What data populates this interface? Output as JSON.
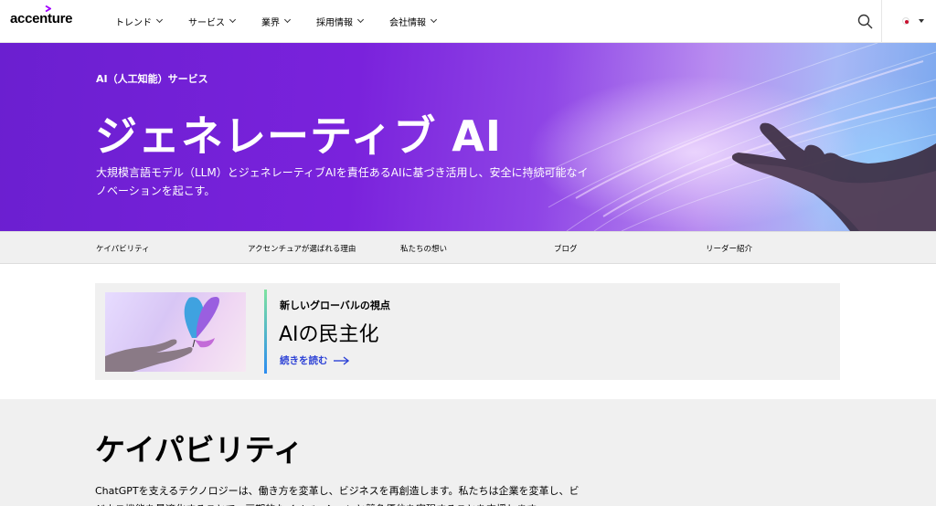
{
  "header": {
    "logo": "accenture",
    "nav": [
      {
        "label": "トレンド"
      },
      {
        "label": "サービス"
      },
      {
        "label": "業界"
      },
      {
        "label": "採用情報"
      },
      {
        "label": "会社情報"
      }
    ],
    "search_icon": "search-icon",
    "locale_icon": "japan-flag-icon"
  },
  "hero": {
    "eyebrow": "AI（人工知能）サービス",
    "title": "ジェネレーティブ AI",
    "description": "大規模言語モデル（LLM）とジェネレーティブAIを責任あるAIに基づき活用し、安全に持続可能なイノベーションを起こす。"
  },
  "subnav": [
    {
      "label": "ケイパビリティ"
    },
    {
      "label": "アクセンチュアが選ばれる理由"
    },
    {
      "label": "私たちの想い"
    },
    {
      "label": "ブログ"
    },
    {
      "label": "リーダー紹介"
    }
  ],
  "promo": {
    "eyebrow": "新しいグローバルの視点",
    "title": "AIの民主化",
    "link": "続きを読む"
  },
  "section": {
    "title": "ケイパビリティ",
    "body": "ChatGPTを支えるテクノロジーは、働き方を変革し、ビジネスを再創造します。私たちは企業を変革し、ビジネス機能を最適化することで、画期的なイノベーションと競争優位を実現することを支援します。"
  },
  "colors": {
    "brand_purple": "#a100ff",
    "hero_purple": "#7a22dc",
    "link_blue": "#2e43d6"
  }
}
